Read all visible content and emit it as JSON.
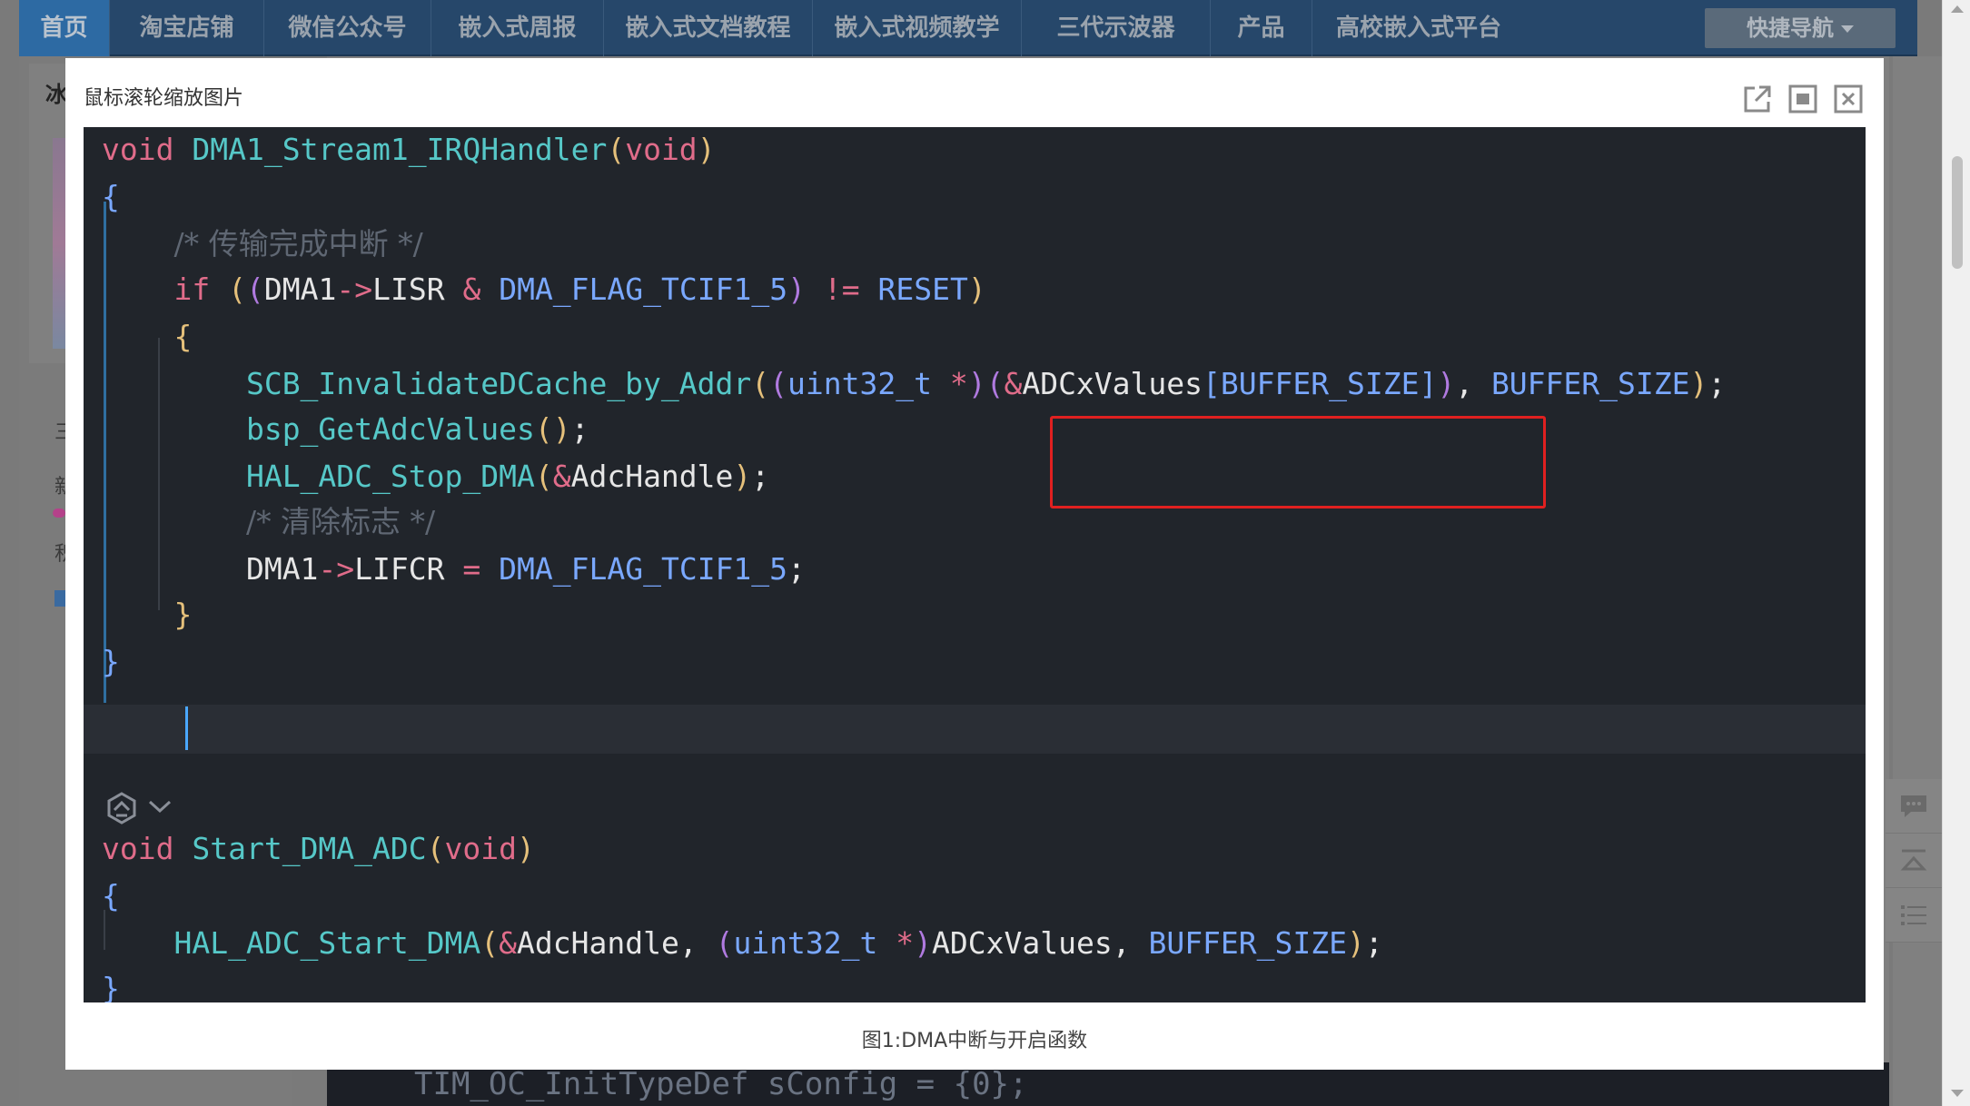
{
  "nav": {
    "items": [
      "首页",
      "淘宝店铺",
      "微信公众号",
      "嵌入式周报",
      "嵌入式文档教程",
      "嵌入式视频教学",
      "三代示波器",
      "产品",
      "高校嵌入式平台"
    ],
    "quick_nav": "快捷导航"
  },
  "background": {
    "left_word": "冰",
    "side_chars": [
      "三",
      "新",
      "积"
    ],
    "code_snippet": "TIM_OC_InitTypeDef sConfig = {0};"
  },
  "dialog": {
    "title": "鼠标滚轮缩放图片",
    "caption": "图1:DMA中断与开启函数",
    "buttons": [
      "open-external",
      "fit-screen",
      "close"
    ]
  },
  "code": {
    "lines": [
      "void DMA1_Stream1_IRQHandler(void)",
      "{",
      "    /* 传输完成中断 */",
      "    if ((DMA1->LISR & DMA_FLAG_TCIF1_5) != RESET)",
      "    {",
      "        SCB_InvalidateDCache_by_Addr((uint32_t *)(&ADCxValues[BUFFER_SIZE]), BUFFER_SIZE);",
      "        bsp_GetAdcValues();",
      "        HAL_ADC_Stop_DMA(&AdcHandle);",
      "        /* 清除标志 */",
      "        DMA1->LIFCR = DMA_FLAG_TCIF1_5;",
      "    }",
      "}",
      "void Start_DMA_ADC(void)",
      "{",
      "    HAL_ADC_Start_DMA(&AdcHandle, (uint32_t *)ADCxValues, BUFFER_SIZE);",
      "}"
    ],
    "highlighted_expression": "(&ADCxValues[BUFFER_SIZE])"
  },
  "colors": {
    "keyword": "#e06c8a",
    "function": "#56c8c8",
    "macro": "#7aa8ff",
    "highlight_box": "#e02020",
    "code_background": "#21252b"
  }
}
